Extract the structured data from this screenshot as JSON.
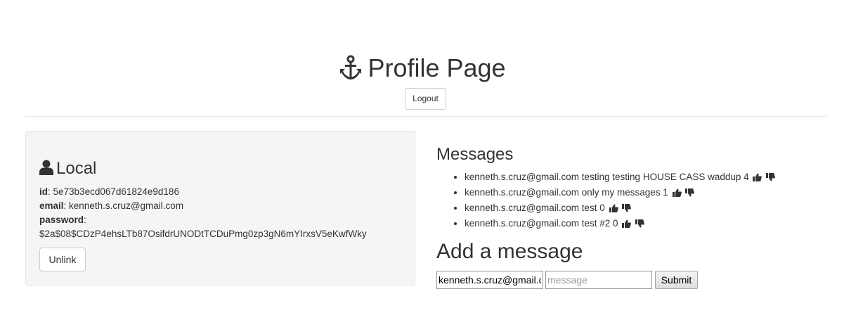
{
  "header": {
    "title": "Profile Page",
    "icon": "anchor-icon",
    "logout_label": "Logout"
  },
  "local": {
    "heading": "Local",
    "icon": "user-icon",
    "id_label": "id",
    "id_value": "5e73b3ecd067d61824e9d186",
    "email_label": "email",
    "email_value": "kenneth.s.cruz@gmail.com",
    "password_label": "password",
    "password_value": "$2a$08$CDzP4ehsLTb87OsifdrUNODtTCDuPmg0zp3gN6mYIrxsV5eKwfWky",
    "unlink_label": "Unlink"
  },
  "messages": {
    "heading": "Messages",
    "items": [
      {
        "text": "kenneth.s.cruz@gmail.com testing testing HOUSE CASS waddup 4"
      },
      {
        "text": "kenneth.s.cruz@gmail.com only my messages 1"
      },
      {
        "text": "kenneth.s.cruz@gmail.com test 0"
      },
      {
        "text": "kenneth.s.cruz@gmail.com test #2 0"
      }
    ]
  },
  "add_message": {
    "heading": "Add a message",
    "email_value": "kenneth.s.cruz@gmail.com",
    "message_placeholder": "message",
    "submit_label": "Submit"
  }
}
